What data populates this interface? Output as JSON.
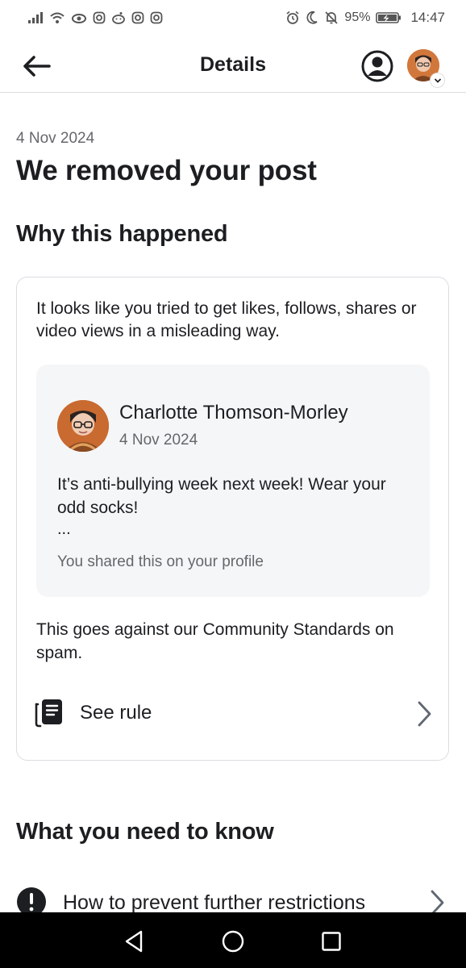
{
  "status_bar": {
    "battery_percent": "95%",
    "time": "14:47",
    "icons_left": [
      "signal-icon",
      "wifi-icon",
      "eye-icon",
      "instagram-icon",
      "reddit-icon",
      "instagram-icon",
      "instagram-icon"
    ],
    "icons_right": [
      "alarm-icon",
      "moon-icon",
      "bell-off-icon",
      "battery-icon"
    ]
  },
  "header": {
    "title": "Details",
    "icons": [
      "back-arrow-icon",
      "profile-icon",
      "account-avatar"
    ]
  },
  "main": {
    "date": "4 Nov 2024",
    "title": "We removed your post",
    "why_heading": "Why this happened",
    "card": {
      "intro": "It looks like you tried to get likes, follows, shares or video views in a misleading way.",
      "post": {
        "author": "Charlotte Thomson-Morley",
        "date": "4 Nov 2024",
        "text": "It’s anti-bullying week next week! Wear your odd socks!",
        "ellipsis": "...",
        "shared_note": "You shared this on your profile"
      },
      "standards_text": "This goes against our Community Standards on spam.",
      "see_rule_label": "See rule"
    },
    "know_heading": "What you need to know",
    "prevent_label": "How to prevent further restrictions"
  },
  "colors": {
    "text_primary": "#1c1e21",
    "text_secondary": "#65676b",
    "preview_background": "#f5f6f8",
    "card_border": "#dadde1",
    "nav_bar": "#000000"
  }
}
